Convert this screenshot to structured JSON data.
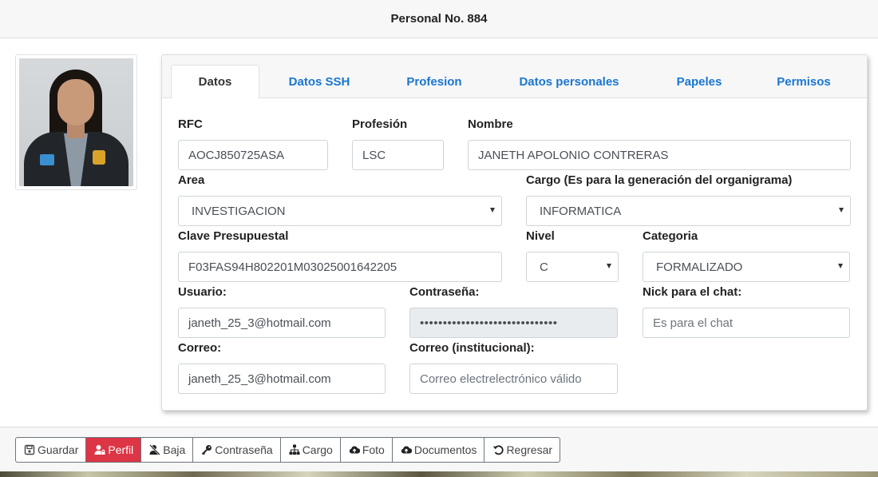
{
  "header": {
    "title": "Personal No. 884"
  },
  "tabs": [
    "Datos",
    "Datos SSH",
    "Profesion",
    "Datos personales",
    "Papeles",
    "Permisos"
  ],
  "form": {
    "rfc": {
      "label": "RFC",
      "value": "AOCJ850725ASA"
    },
    "profesion": {
      "label": "Profesión",
      "value": "LSC"
    },
    "nombre": {
      "label": "Nombre",
      "value": "JANETH APOLONIO CONTRERAS"
    },
    "area": {
      "label": "Area",
      "value": "INVESTIGACION"
    },
    "cargo": {
      "label": "Cargo (Es para la generación del organigrama)",
      "value": "INFORMATICA"
    },
    "clave": {
      "label": "Clave Presupuestal",
      "value": "F03FAS94H802201M03025001642205"
    },
    "nivel": {
      "label": "Nivel",
      "value": "C"
    },
    "categoria": {
      "label": "Categoria",
      "value": "FORMALIZADO"
    },
    "usuario": {
      "label": "Usuario:",
      "value": "janeth_25_3@hotmail.com"
    },
    "contrasena": {
      "label": "Contraseña:",
      "value": "••••••••••••••••••••••••••••••"
    },
    "nick": {
      "label": "Nick para el chat:",
      "placeholder": "Es para el chat"
    },
    "correo": {
      "label": "Correo:",
      "value": "janeth_25_3@hotmail.com"
    },
    "correo_inst": {
      "label": "Correo (institucional):",
      "placeholder": "Correo electrelectrónico válido"
    }
  },
  "actions": [
    {
      "label": "Guardar",
      "icon": "save-icon"
    },
    {
      "label": "Perfil",
      "icon": "user-lock-icon",
      "active": true
    },
    {
      "label": "Baja",
      "icon": "user-remove-icon"
    },
    {
      "label": "Contraseña",
      "icon": "key-icon"
    },
    {
      "label": "Cargo",
      "icon": "org-chart-icon"
    },
    {
      "label": "Foto",
      "icon": "cloud-upload-icon"
    },
    {
      "label": "Documentos",
      "icon": "cloud-upload-icon"
    },
    {
      "label": "Regresar",
      "icon": "undo-icon"
    }
  ],
  "colors": {
    "accent": "#1976d2",
    "danger": "#dc3545"
  }
}
